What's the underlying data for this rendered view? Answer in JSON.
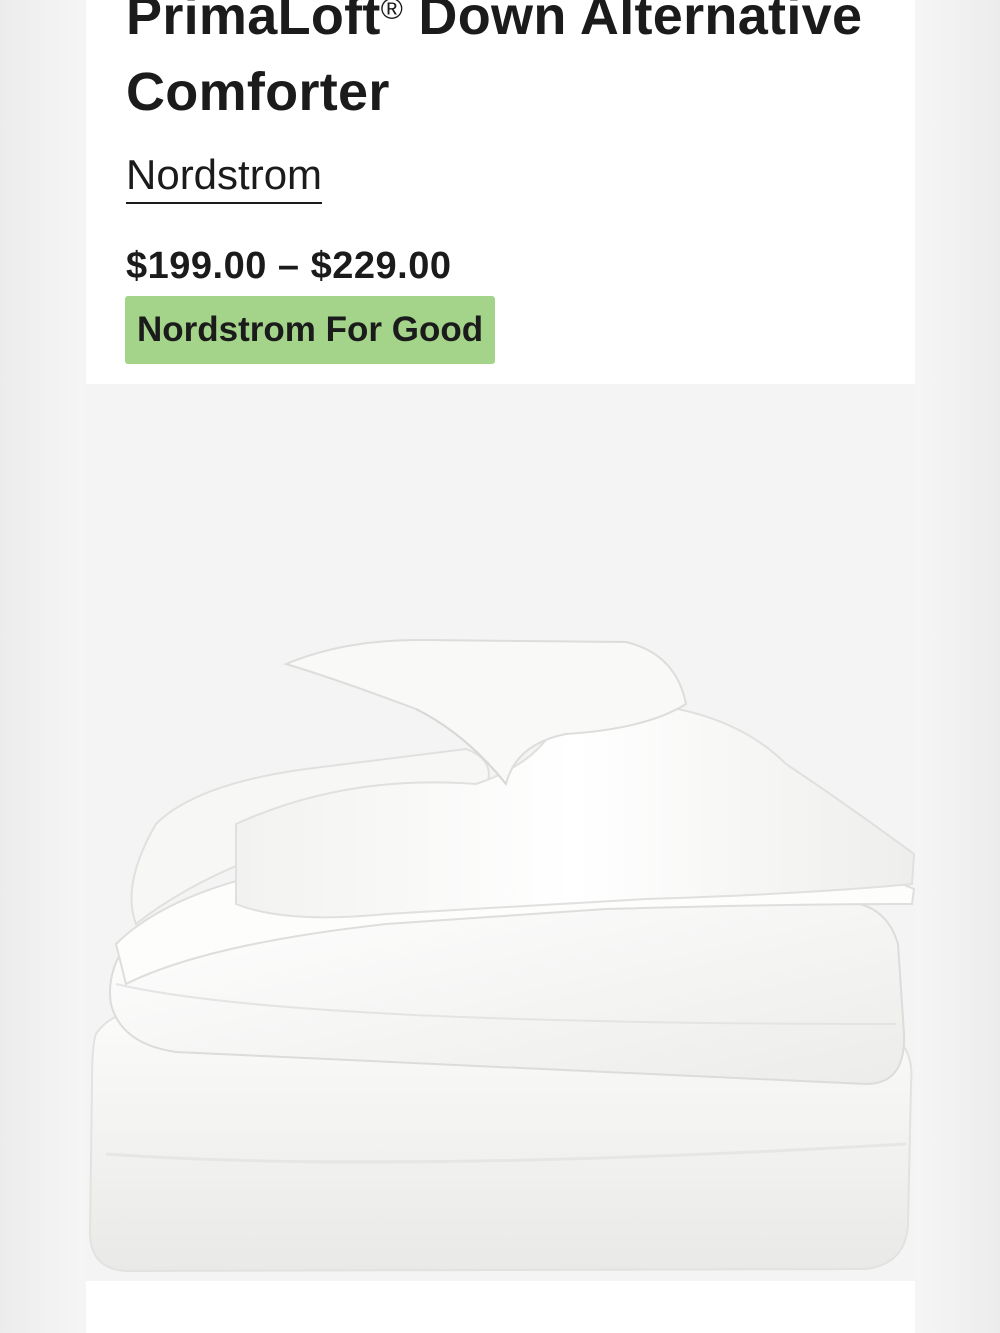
{
  "product": {
    "title_main": "PrimaLoft",
    "title_reg": "®",
    "title_rest": " Down Alternative Comforter",
    "brand": "Nordstrom",
    "price": "$199.00 – $229.00",
    "badge": "Nordstrom For Good"
  },
  "colors": {
    "badge_bg": "#a3d48a",
    "text": "#1b1b1b"
  },
  "image": {
    "subject": "folded white comforter"
  }
}
